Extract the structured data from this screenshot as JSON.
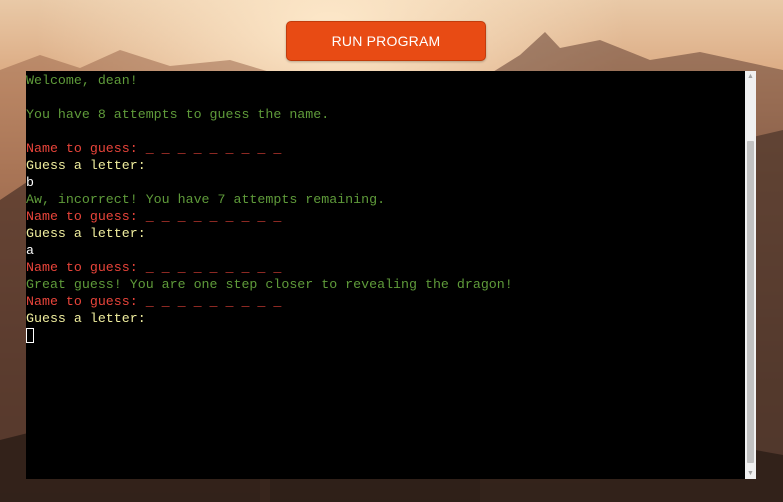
{
  "toolbar": {
    "run_label": "RUN PROGRAM"
  },
  "terminal": {
    "lines": [
      {
        "text": "Welcome, dean!",
        "color": "green"
      },
      {
        "text": "",
        "color": "green"
      },
      {
        "text": "You have 8 attempts to guess the name.",
        "color": "green"
      },
      {
        "text": "",
        "color": "green"
      },
      {
        "prefix": "Name to guess: ",
        "text": "_ _ _ _ _ _ _ _ _",
        "color": "red"
      },
      {
        "text": "Guess a letter:",
        "color": "yellow"
      },
      {
        "text": "b",
        "color": "white"
      },
      {
        "text": "Aw, incorrect! You have 7 attempts remaining.",
        "color": "green"
      },
      {
        "prefix": "Name to guess: ",
        "text": "_ _ _ _ _ _ _ _ _",
        "color": "red"
      },
      {
        "text": "Guess a letter:",
        "color": "yellow"
      },
      {
        "text": "a",
        "color": "white"
      },
      {
        "prefix": "Name to guess: ",
        "text": "_ _ _ _ _ _ _ _ _",
        "color": "red"
      },
      {
        "text": "Great guess! You are one step closer to revealing the dragon!",
        "color": "green"
      },
      {
        "prefix": "Name to guess: ",
        "text": "_ _ _ _ _ _ _ _ _",
        "color": "red"
      },
      {
        "text": "Guess a letter:",
        "color": "yellow"
      }
    ]
  },
  "colors": {
    "run_button": "#e84b14",
    "terminal_bg": "#000000",
    "green_text": "#5f9b3a",
    "red_text": "#e8443a",
    "yellow_text": "#f0ee9e",
    "input_text": "#ffffff"
  },
  "icons": {
    "scroll_up": "triangle-up-icon",
    "scroll_down": "triangle-down-icon"
  }
}
